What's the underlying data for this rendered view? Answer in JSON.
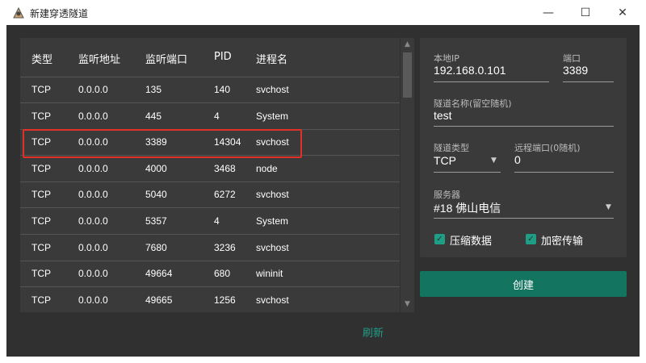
{
  "window": {
    "title": "新建穿透隧道",
    "minimize": "—",
    "maximize": "☐",
    "close": "✕"
  },
  "table": {
    "columns": [
      "类型",
      "监听地址",
      "监听端口",
      "PID",
      "进程名"
    ],
    "rows": [
      [
        "TCP",
        "0.0.0.0",
        "135",
        "140",
        "svchost"
      ],
      [
        "TCP",
        "0.0.0.0",
        "445",
        "4",
        "System"
      ],
      [
        "TCP",
        "0.0.0.0",
        "3389",
        "14304",
        "svchost"
      ],
      [
        "TCP",
        "0.0.0.0",
        "4000",
        "3468",
        "node"
      ],
      [
        "TCP",
        "0.0.0.0",
        "5040",
        "6272",
        "svchost"
      ],
      [
        "TCP",
        "0.0.0.0",
        "5357",
        "4",
        "System"
      ],
      [
        "TCP",
        "0.0.0.0",
        "7680",
        "3236",
        "svchost"
      ],
      [
        "TCP",
        "0.0.0.0",
        "49664",
        "680",
        "wininit"
      ],
      [
        "TCP",
        "0.0.0.0",
        "49665",
        "1256",
        "svchost"
      ]
    ],
    "highlighted_row": 2
  },
  "refresh_label": "刷新",
  "form": {
    "local_ip_label": "本地IP",
    "local_ip_value": "192.168.0.101",
    "port_label": "端口",
    "port_value": "3389",
    "tunnel_name_label": "隧道名称(留空随机)",
    "tunnel_name_value": "test",
    "tunnel_type_label": "隧道类型",
    "tunnel_type_value": "TCP",
    "remote_port_label": "远程端口(0随机)",
    "remote_port_value": "0",
    "server_label": "服务器",
    "server_value": "#18 佛山电信",
    "compress_label": "压缩数据",
    "compress_checked": true,
    "encrypt_label": "加密传输",
    "encrypt_checked": true
  },
  "create_label": "创建",
  "colors": {
    "accent": "#1e9e85",
    "button": "#137460",
    "highlight": "#e03028",
    "background": "#303030"
  }
}
